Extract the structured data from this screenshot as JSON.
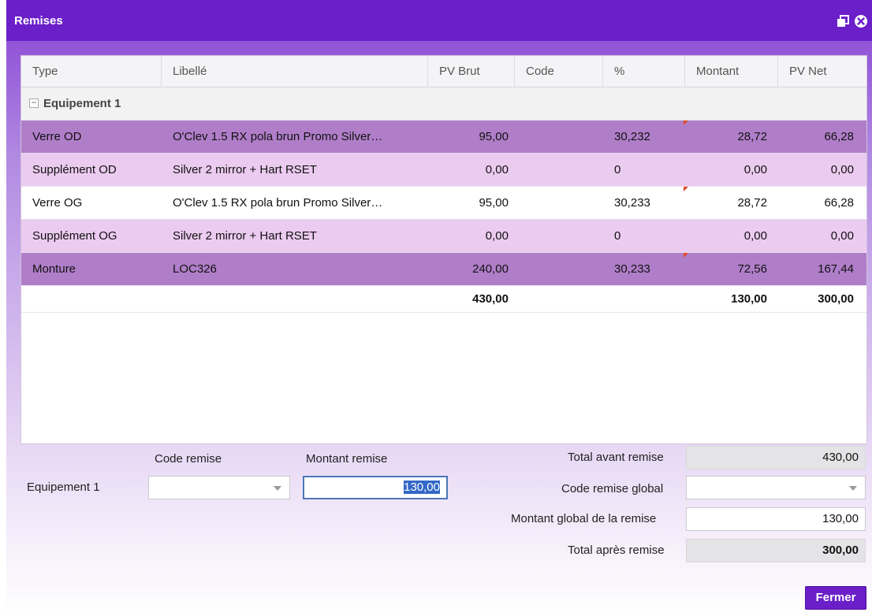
{
  "window": {
    "title": "Remises"
  },
  "grid": {
    "headers": [
      "Type",
      "Libellé",
      "PV Brut",
      "Code",
      "%",
      "Montant",
      "PV Net"
    ],
    "group": {
      "label": "Equipement 1",
      "toggle": "−"
    },
    "rows": [
      {
        "type": "Verre OD",
        "libelle": "O'Clev 1.5 RX pola brun Promo Silver…",
        "pv_brut": "95,00",
        "code": "",
        "pct": "30,232",
        "montant": "28,72",
        "pv_net": "66,28"
      },
      {
        "type": "Supplément OD",
        "libelle": "Silver 2 mirror + Hart RSET",
        "pv_brut": "0,00",
        "code": "",
        "pct": "0",
        "montant": "0,00",
        "pv_net": "0,00"
      },
      {
        "type": "Verre OG",
        "libelle": "O'Clev 1.5 RX pola brun Promo Silver…",
        "pv_brut": "95,00",
        "code": "",
        "pct": "30,233",
        "montant": "28,72",
        "pv_net": "66,28"
      },
      {
        "type": "Supplément OG",
        "libelle": "Silver 2 mirror + Hart RSET",
        "pv_brut": "0,00",
        "code": "",
        "pct": "0",
        "montant": "0,00",
        "pv_net": "0,00"
      },
      {
        "type": "Monture",
        "libelle": "LOC326",
        "pv_brut": "240,00",
        "code": "",
        "pct": "30,233",
        "montant": "72,56",
        "pv_net": "167,44"
      }
    ],
    "totals": {
      "pv_brut": "430,00",
      "montant": "130,00",
      "pv_net": "300,00"
    }
  },
  "form": {
    "code_remise_label": "Code remise",
    "montant_remise_label": "Montant remise",
    "equipement_label": "Equipement 1",
    "code_remise_value": "",
    "montant_remise_value": "130,00",
    "total_avant_label": "Total avant remise",
    "total_avant_value": "430,00",
    "code_global_label": "Code remise global",
    "code_global_value": "",
    "montant_global_label": "Montant global de la remise",
    "montant_global_value": "130,00",
    "total_apres_label": "Total après remise",
    "total_apres_value": "300,00"
  },
  "buttons": {
    "close_label": "Fermer"
  },
  "colors": {
    "titlebar": "#6a1fc9",
    "row_dark": "#b07ec9",
    "row_light": "#eccbf0"
  }
}
